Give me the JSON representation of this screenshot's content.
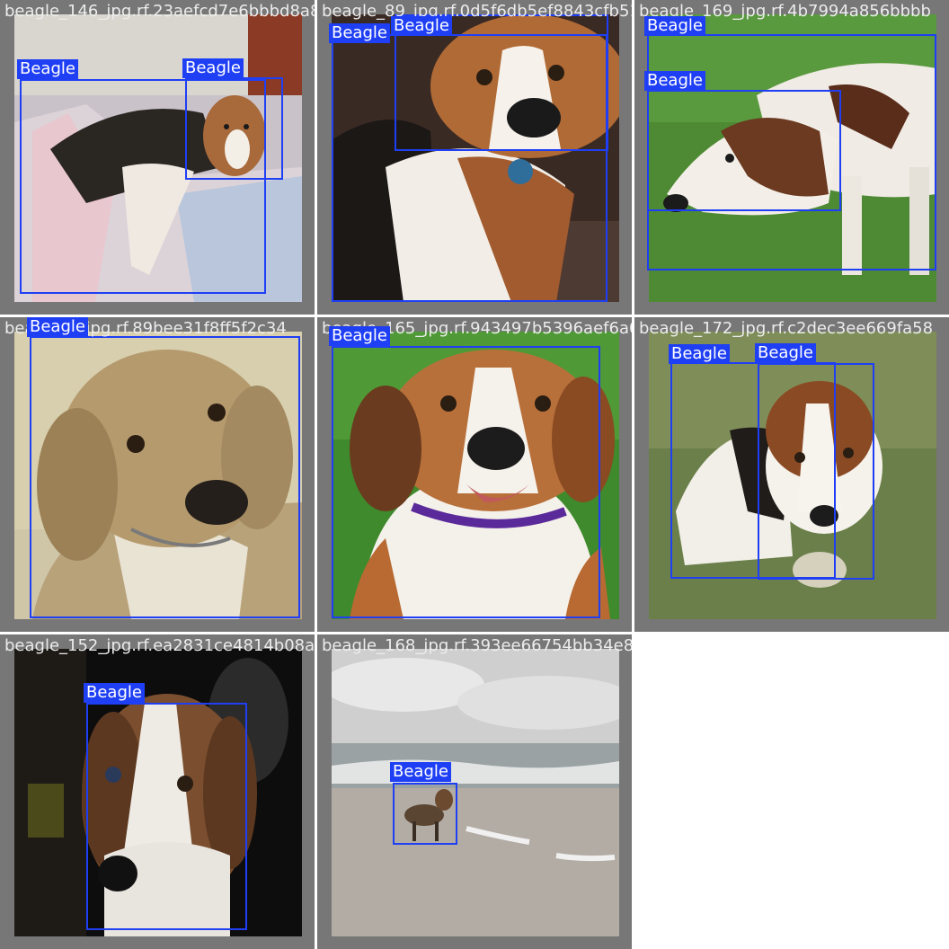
{
  "images": [
    {
      "filename": "beagle_146_jpg.rf.23aefcd7e6bbbd8a8e8c4e",
      "labels": [
        "Beagle",
        "Beagle"
      ]
    },
    {
      "filename": "beagle_89_jpg.rf.0d5f6db5ef8843cfb5137f",
      "labels": [
        "Beagle",
        "Beagle"
      ]
    },
    {
      "filename": "beagle_169_jpg.rf.4b7994a856bbbb",
      "labels": [
        "Beagle",
        "Beagle"
      ]
    },
    {
      "filename": "beagle_7_jpg.rf.89bee31f8ff5f2c34",
      "labels": [
        "Beagle"
      ]
    },
    {
      "filename": "beagle_165_jpg.rf.943497b5396aef6a03d73",
      "labels": [
        "Beagle"
      ]
    },
    {
      "filename": "beagle_172_jpg.rf.c2dec3ee669fa58",
      "labels": [
        "Beagle",
        "Beagle"
      ]
    },
    {
      "filename": "beagle_152_jpg.rf.ea2831ce4814b08af1e9",
      "labels": [
        "Beagle"
      ]
    },
    {
      "filename": "beagle_168_jpg.rf.393ee66754bb34e83fd284",
      "labels": [
        "Beagle"
      ]
    }
  ],
  "colors": {
    "box": "#1f3ff5",
    "tile_bg": "#777777",
    "filename_text": "#ececec"
  }
}
